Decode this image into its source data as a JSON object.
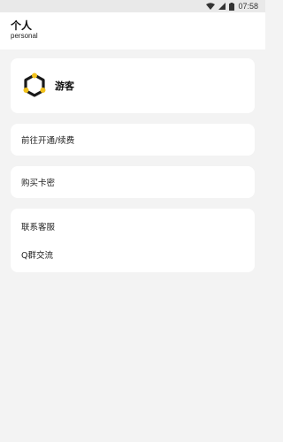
{
  "status_bar": {
    "time": "07:58",
    "icons": [
      "wifi-icon",
      "signal-icon",
      "battery-icon"
    ]
  },
  "header": {
    "title": "个人",
    "subtitle": "personal"
  },
  "profile": {
    "name": "游客",
    "logo_icon": "hexagon-logo-icon",
    "accent_color": "#f2c21b",
    "logo_color": "#1a1a1a"
  },
  "menu": {
    "subscribe_label": "前往开通/续费",
    "buy_card_label": "购买卡密",
    "contact_label": "联系客服",
    "qq_group_label": "Q群交流"
  }
}
